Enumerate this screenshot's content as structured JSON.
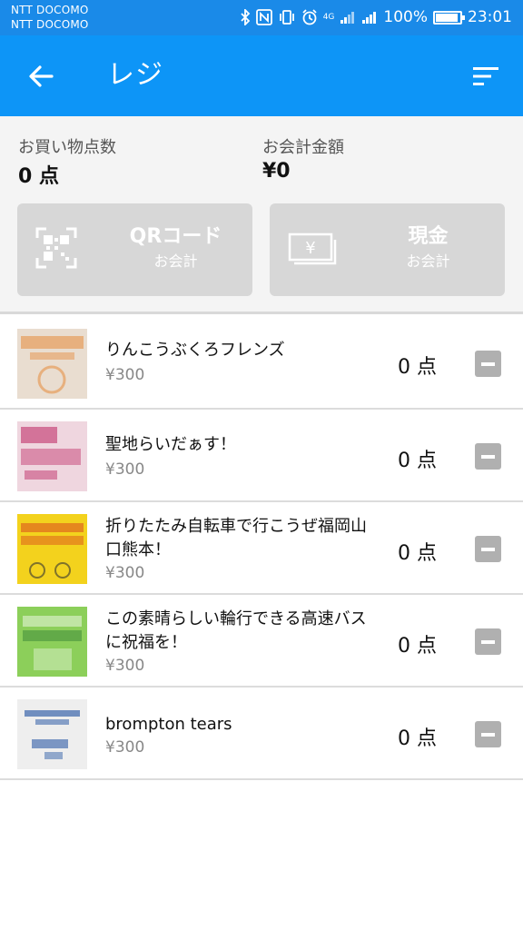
{
  "status_bar": {
    "carrier_1": "NTT DOCOMO",
    "carrier_2": "NTT DOCOMO",
    "network": "4G",
    "battery": "100%",
    "battery_level": 1.0,
    "time": "23:01"
  },
  "app_bar": {
    "title": "レジ",
    "back_icon": "arrow-left-icon",
    "sort_icon": "sort-icon"
  },
  "summary": {
    "items_label": "お買い物点数",
    "items_value": "0 点",
    "total_label": "お会計金額",
    "total_value": "¥0",
    "qr_button": {
      "main": "QRコード",
      "sub": "お会計",
      "icon": "qr-code-icon"
    },
    "cash_button": {
      "main": "現金",
      "sub": "お会計",
      "icon": "cash-icon"
    }
  },
  "products": [
    {
      "name": "りんこうぶくろフレンズ",
      "price": "¥300",
      "qty": "0 点",
      "thumb_color": "#e9ddd0",
      "accent": "#e58a3a"
    },
    {
      "name": "聖地らいだぁす！",
      "price": "¥300",
      "qty": "0 点",
      "thumb_color": "#efd6df",
      "accent": "#c0306a"
    },
    {
      "name": "折りたたみ自転車で行こうぜ福岡山口熊本！",
      "price": "¥300",
      "qty": "0 点",
      "thumb_color": "#f3d21d",
      "accent": "#d9481f"
    },
    {
      "name": "この素晴らしい輪行できる高速バスに祝福を！",
      "price": "¥300",
      "qty": "0 点",
      "thumb_color": "#8ccf5a",
      "accent": "#2e7d32"
    },
    {
      "name": "brompton tears",
      "price": "¥300",
      "qty": "0 点",
      "thumb_color": "#eeeeee",
      "accent": "#1d4fa0"
    }
  ],
  "colors": {
    "status_bar": "#1a8ae8",
    "app_bar": "#0d95f7",
    "button_disabled": "#d7d7d7",
    "minus_button": "#b0b0b0"
  }
}
